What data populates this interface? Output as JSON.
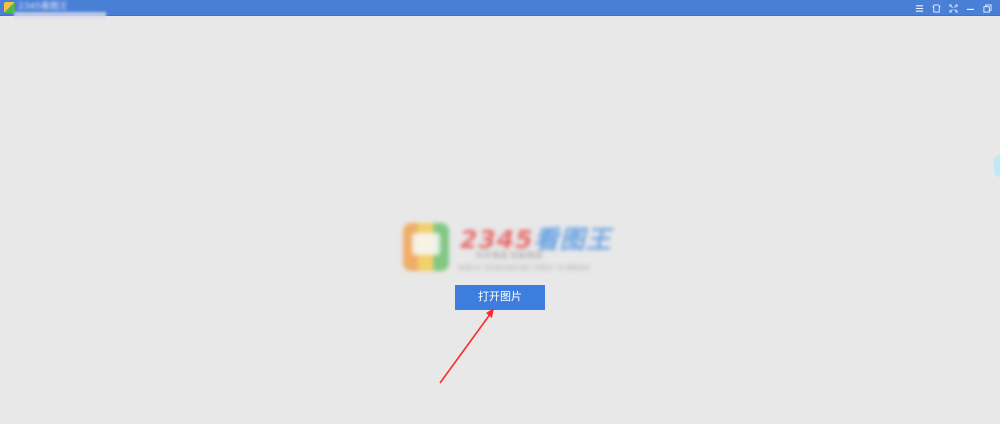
{
  "window": {
    "title": "2345看图王"
  },
  "titlebar_controls": [
    {
      "name": "menu-icon",
      "label": "菜单"
    },
    {
      "name": "skin-icon",
      "label": "皮肤"
    },
    {
      "name": "fullscreen-icon",
      "label": "全屏"
    },
    {
      "name": "minimize-icon",
      "label": "最小化"
    },
    {
      "name": "restore-icon",
      "label": "还原"
    }
  ],
  "logo": {
    "brand_num": "2345",
    "brand_text": "看图王",
    "line1": "科学看图 智能看图",
    "line2": "极速打开 支持更多图片格式 免费无广告 精致体验"
  },
  "main": {
    "open_button_label": "打开图片"
  },
  "colors": {
    "titlebar": "#4a7fd6",
    "background": "#e8e8e8",
    "button": "#3c7ddd",
    "annotation_arrow": "#ff2a2a"
  }
}
